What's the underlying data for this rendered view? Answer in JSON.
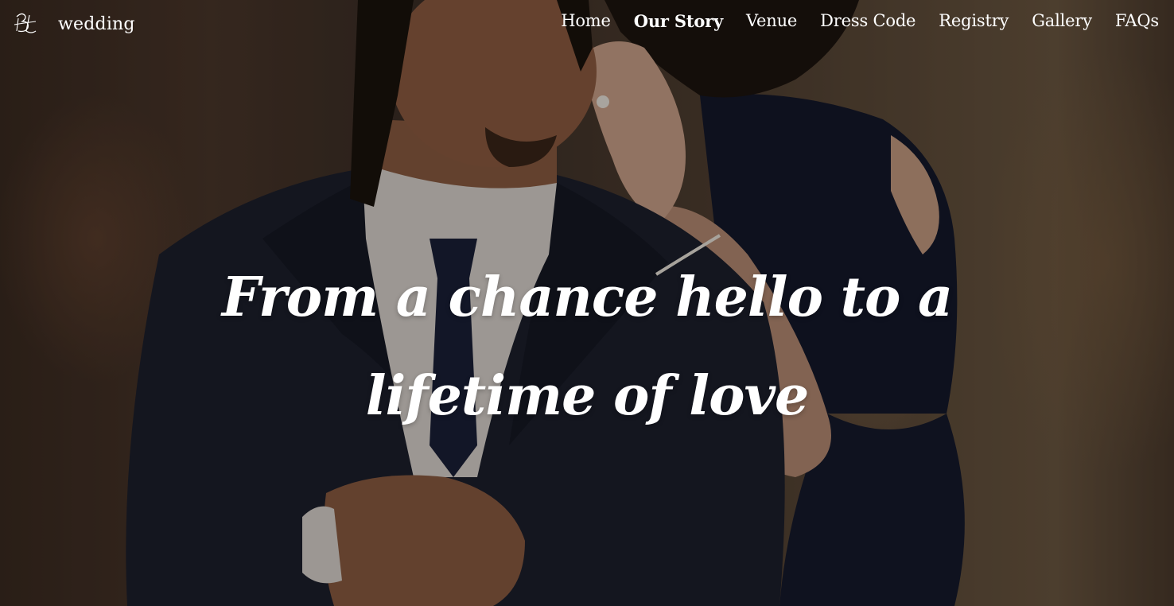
{
  "brand": {
    "monogram": "BL",
    "name": "wedding"
  },
  "nav": {
    "items": [
      {
        "label": "Home",
        "active": false
      },
      {
        "label": "Our Story",
        "active": true
      },
      {
        "label": "Venue",
        "active": false
      },
      {
        "label": "Dress Code",
        "active": false
      },
      {
        "label": "Registry",
        "active": false
      },
      {
        "label": "Gallery",
        "active": false
      },
      {
        "label": "FAQs",
        "active": false
      }
    ]
  },
  "hero": {
    "headline_line1": "From a chance hello to a",
    "headline_line2": "lifetime of love",
    "text_color": "#ffffff"
  }
}
